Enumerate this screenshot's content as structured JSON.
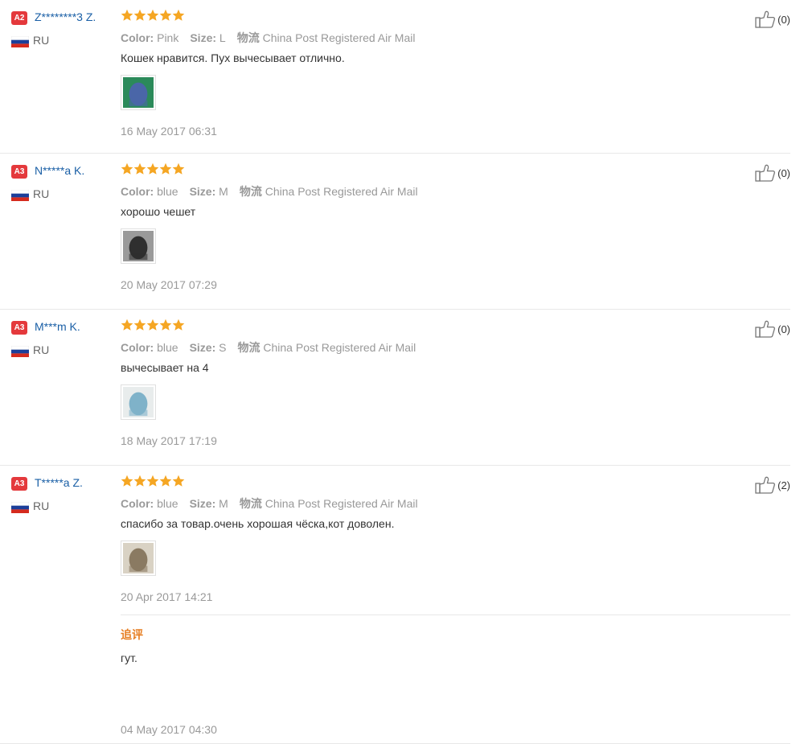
{
  "reviews": [
    {
      "level": "A2",
      "name": "Z********3 Z.",
      "country": "RU",
      "rating": 5,
      "color_label": "Color:",
      "color": "Pink",
      "size_label": "Size:",
      "size": "L",
      "logistics_label": "物流",
      "logistics": "China Post Registered Air Mail",
      "comment": "Кошек нравится. Пух вычесывает отлично.",
      "date": "16 May 2017 06:31",
      "helpful": "(0)",
      "thumb_colors": [
        "#4a66a8",
        "#2b8a5a"
      ]
    },
    {
      "level": "A3",
      "name": "N*****a K.",
      "country": "RU",
      "rating": 5,
      "color_label": "Color:",
      "color": "blue",
      "size_label": "Size:",
      "size": "M",
      "logistics_label": "物流",
      "logistics": "China Post Registered Air Mail",
      "comment": "хорошо чешет",
      "date": "20 May 2017 07:29",
      "helpful": "(0)",
      "thumb_colors": [
        "#2f2f2f",
        "#9a9a9a"
      ]
    },
    {
      "level": "A3",
      "name": "M***m K.",
      "country": "RU",
      "rating": 5,
      "color_label": "Color:",
      "color": "blue",
      "size_label": "Size:",
      "size": "S",
      "logistics_label": "物流",
      "logistics": "China Post Registered Air Mail",
      "comment": "вычесывает на 4",
      "date": "18 May 2017 17:19",
      "helpful": "(0)",
      "thumb_colors": [
        "#7fb2c9",
        "#e8ecec"
      ]
    },
    {
      "level": "A3",
      "name": "T*****a Z.",
      "country": "RU",
      "rating": 5,
      "color_label": "Color:",
      "color": "blue",
      "size_label": "Size:",
      "size": "M",
      "logistics_label": "物流",
      "logistics": "China Post Registered Air Mail",
      "comment": "спасибо за товар.очень хорошая чёска,кот доволен.",
      "date": "20 Apr 2017 14:21",
      "helpful": "(2)",
      "thumb_colors": [
        "#8a7a62",
        "#d9d2c4"
      ],
      "followup": {
        "title": "追评",
        "text": "гут.",
        "date": "04 May 2017 04:30"
      }
    }
  ],
  "colors": {
    "name": "#1a5fa6",
    "badge": "#e4393c",
    "star": "#f5a623",
    "followup_title": "#e67e22"
  }
}
